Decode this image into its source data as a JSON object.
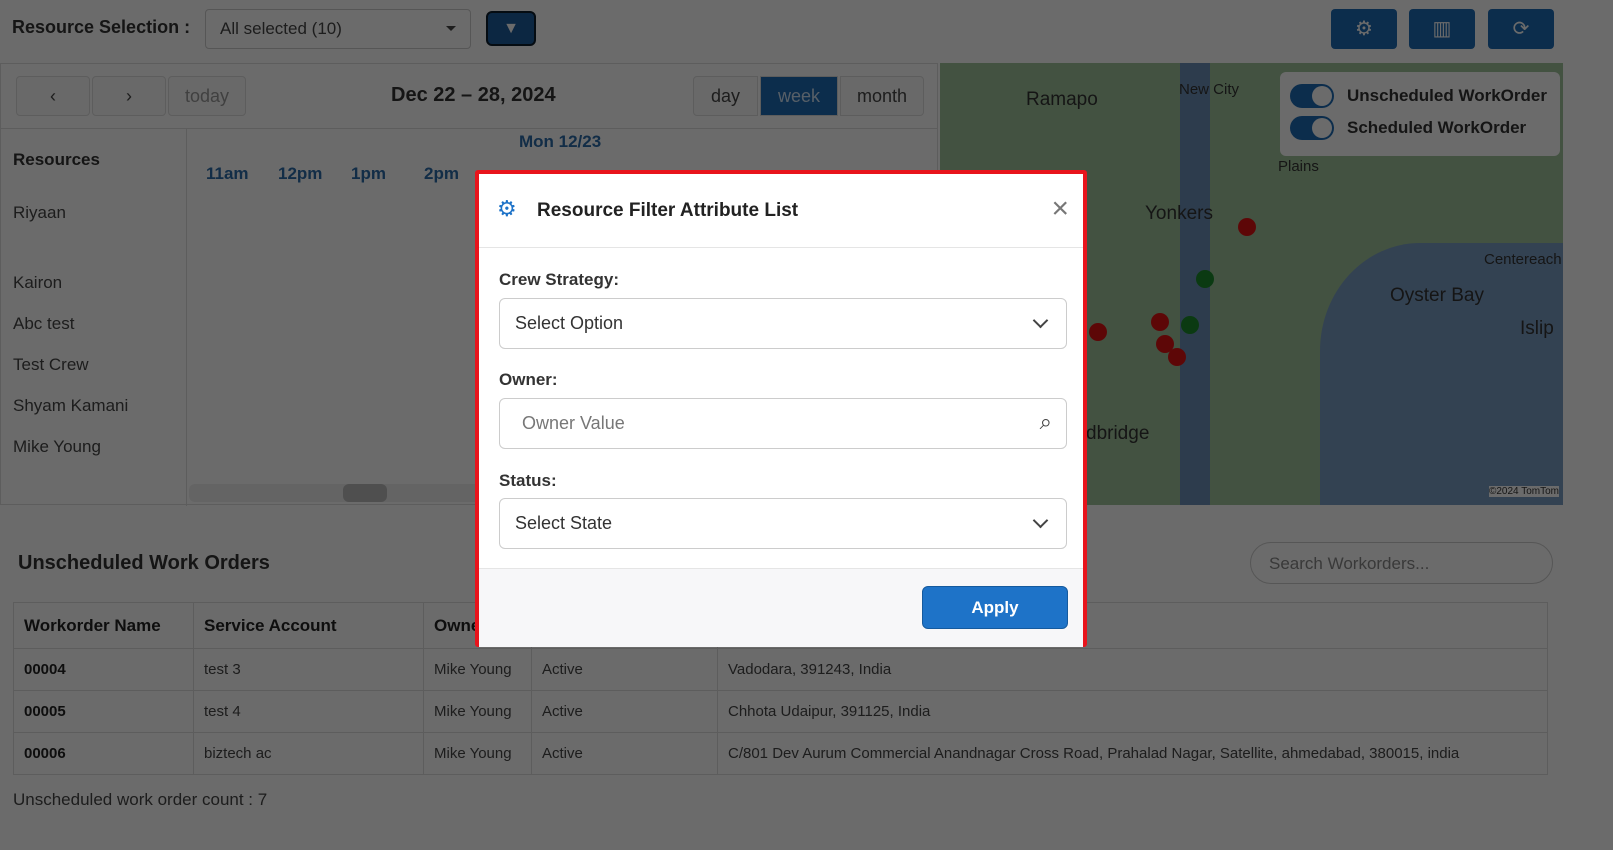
{
  "header": {
    "resource_label": "Resource Selection :",
    "resource_value": "All selected (10)"
  },
  "calendar": {
    "prev": "‹",
    "next": "›",
    "today": "today",
    "range": "Dec 22 – 28, 2024",
    "views": [
      "day",
      "week",
      "month"
    ],
    "active_view": "week",
    "day_header": "Mon 12/23",
    "resources_header": "Resources",
    "hours": [
      "11am",
      "12pm",
      "1pm",
      "2pm"
    ],
    "resources": [
      "Riyaan",
      "Kairon",
      "Abc test",
      "Test Crew",
      "Shyam Kamani",
      "Mike Young"
    ]
  },
  "map": {
    "places": [
      "Ramapo",
      "New City",
      "Yonkers",
      "Oyster Bay",
      "Centereach",
      "Islip",
      "Plains",
      "dbridge"
    ],
    "attribution": "©2024 TomTom",
    "legend": [
      "Unscheduled WorkOrder",
      "Scheduled WorkOrder"
    ]
  },
  "unscheduled": {
    "title": "Unscheduled Work Orders",
    "search_placeholder": "Search Workorders...",
    "columns": [
      "Workorder Name",
      "Service Account",
      "Owner"
    ],
    "rows": [
      [
        "00004",
        "test 3",
        "Mike Young",
        "Active",
        "Vadodara, 391243, India"
      ],
      [
        "00005",
        "test 4",
        "Mike Young",
        "Active",
        "Chhota Udaipur, 391125, India"
      ],
      [
        "00006",
        "biztech ac",
        "Mike Young",
        "Active",
        "C/801 Dev Aurum Commercial Anandnagar Cross Road, Prahalad Nagar, Satellite, ahmedabad, 380015, india"
      ]
    ],
    "count": "Unscheduled work order count : 7"
  },
  "modal": {
    "title": "Resource Filter Attribute List",
    "crew_label": "Crew Strategy:",
    "crew_value": "Select Option",
    "owner_label": "Owner:",
    "owner_placeholder": "Owner Value",
    "status_label": "Status:",
    "status_value": "Select State",
    "apply": "Apply"
  },
  "colors": {
    "primary": "#1d6bb5",
    "highlight_border": "#e8141c"
  }
}
